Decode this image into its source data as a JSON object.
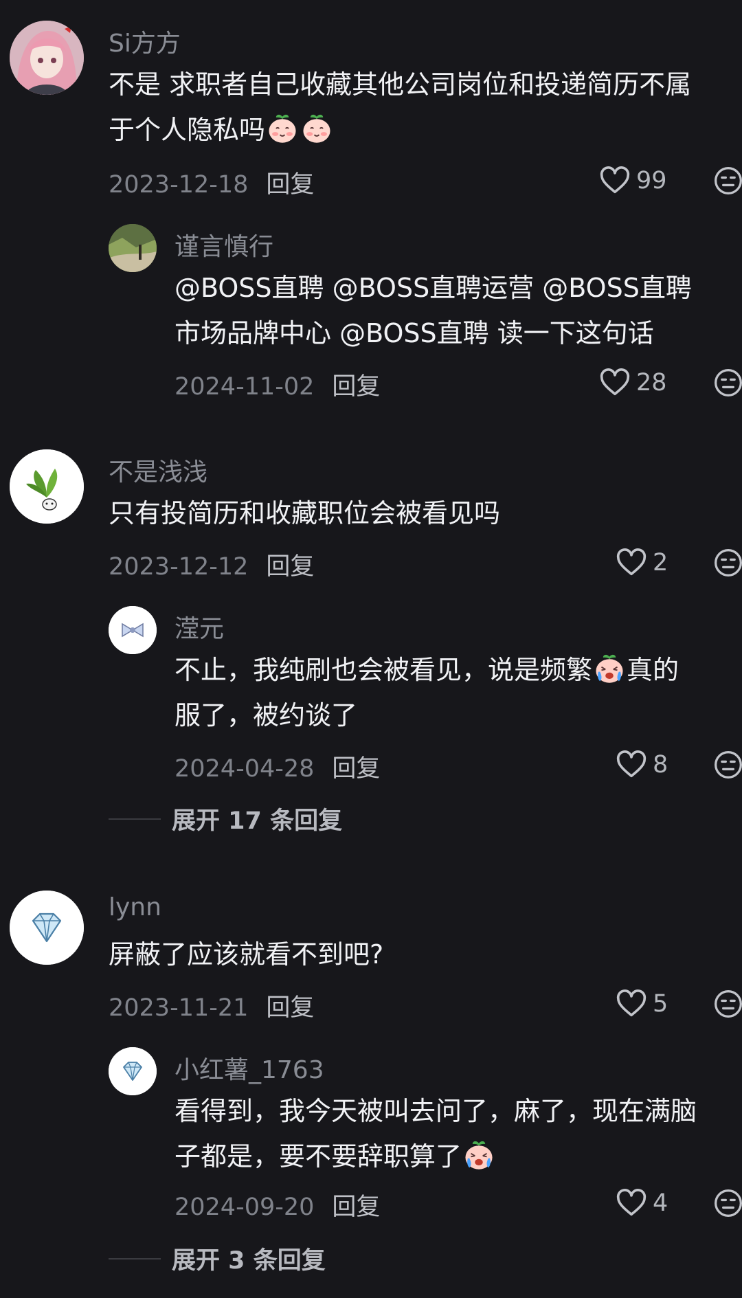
{
  "comments": [
    {
      "user": "Si方方",
      "lines": [
        "不是 求职者自己收藏其他公司岗位和投递简历不属",
        "于个人隐私吗"
      ],
      "date": "2023-12-18",
      "reply_label": "回复",
      "likes": "99",
      "replies": [
        {
          "user": "谨言慎行",
          "lines": [
            "@BOSS直聘 @BOSS直聘运营 @BOSS直聘",
            "市场品牌中心 @BOSS直聘 读一下这句话"
          ],
          "date": "2024-11-02",
          "reply_label": "回复",
          "likes": "28"
        }
      ]
    },
    {
      "user": "不是浅浅",
      "lines": [
        "只有投简历和收藏职位会被看见吗"
      ],
      "date": "2023-12-12",
      "reply_label": "回复",
      "likes": "2",
      "replies": [
        {
          "user": "滢元",
          "lines": [
            "不止，我纯刷也会被看见，说是频繁",
            "服了，被约谈了"
          ],
          "line1_suffix": "真的",
          "date": "2024-04-28",
          "reply_label": "回复",
          "likes": "8"
        }
      ],
      "expand_label": "展开 17 条回复"
    },
    {
      "user": "lynn",
      "lines": [
        "屏蔽了应该就看不到吧?"
      ],
      "date": "2023-11-21",
      "reply_label": "回复",
      "likes": "5",
      "replies": [
        {
          "user": "小红薯_1763",
          "lines": [
            "看得到，我今天被叫去问了，麻了，现在满脑",
            "子都是，要不要辞职算了"
          ],
          "date": "2024-09-20",
          "reply_label": "回复",
          "likes": "4"
        }
      ],
      "expand_label": "展开 3 条回复"
    }
  ],
  "icons": {
    "like": "heart-outline-icon",
    "dislike": "neutral-face-icon"
  }
}
